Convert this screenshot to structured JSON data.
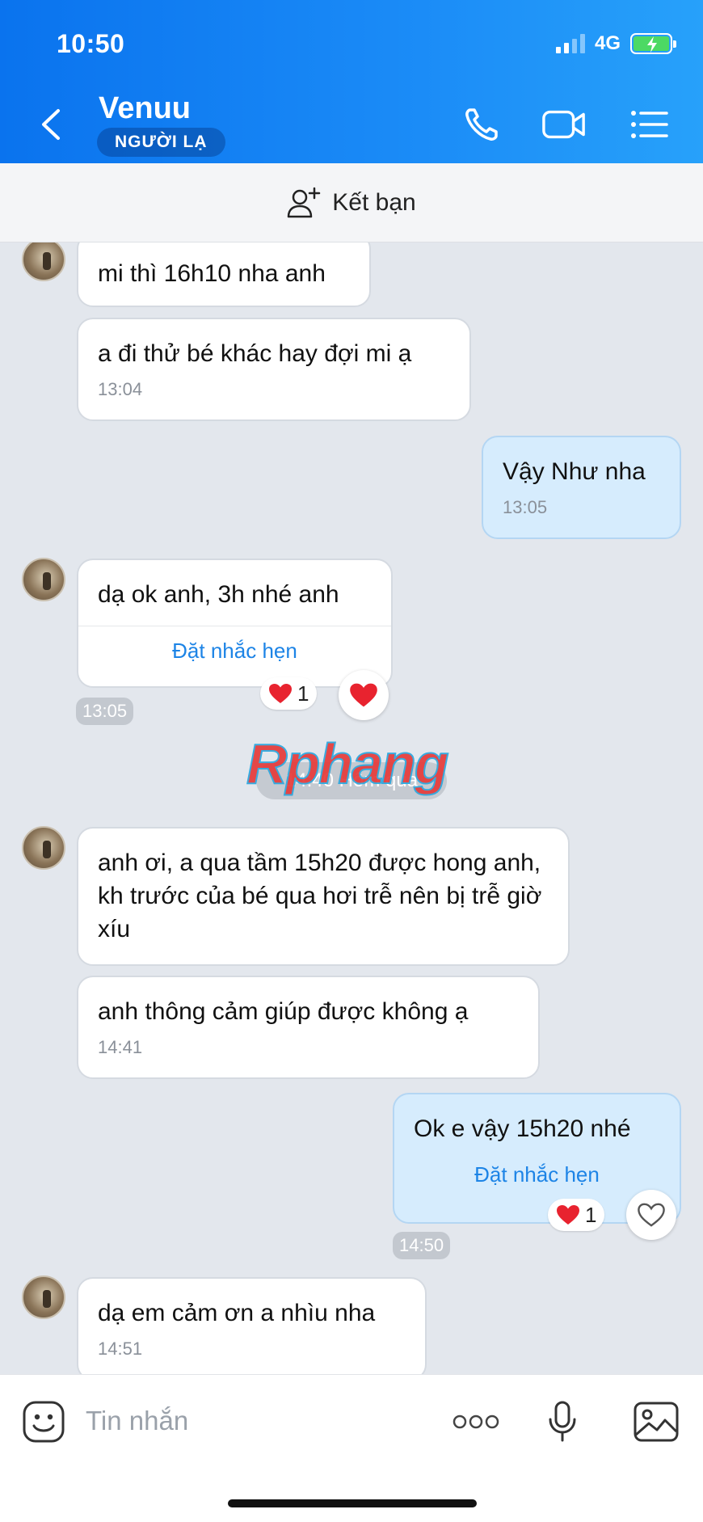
{
  "status_bar": {
    "time": "10:50",
    "network": "4G"
  },
  "header": {
    "contact_name": "Venuu",
    "badge": "NGƯỜI LẠ",
    "icons": [
      "back-icon",
      "phone-icon",
      "video-call-icon",
      "menu-list-icon"
    ]
  },
  "add_friend": {
    "label": "Kết bạn",
    "icon": "add-friend-icon"
  },
  "messages": [
    {
      "from": "them",
      "text": "mi thì 16h10 nha anh"
    },
    {
      "from": "them",
      "text": "a đi thử bé khác hay đợi mi ạ",
      "time": "13:04"
    },
    {
      "from": "me",
      "text": "Vậy Như nha",
      "time": "13:05"
    },
    {
      "from": "them",
      "text": "dạ ok anh, 3h nhé anh",
      "action": "Đặt nhắc hẹn",
      "time": "13:05",
      "reaction_count": "1"
    },
    {
      "from": "them",
      "text": "anh ơi, a qua tầm 15h20 được hong anh, kh trước của bé qua hơi trễ nên bị trễ giờ xíu"
    },
    {
      "from": "them",
      "text": "anh thông cảm giúp được không ạ",
      "time": "14:41"
    },
    {
      "from": "me",
      "text": "Ok e vậy 15h20 nhé",
      "action": "Đặt nhắc hẹn",
      "time": "14:50",
      "reaction_count": "1"
    },
    {
      "from": "them",
      "text": "dạ em cảm ơn a nhìu nha",
      "time": "14:51"
    }
  ],
  "day_separator": "14:40 Hôm qua",
  "watermark": "Rphang",
  "composer": {
    "placeholder": "Tin nhắn",
    "more_label": "ooo"
  },
  "colors": {
    "header": "#0a73ee",
    "my_bubble": "#d6ecfd",
    "link": "#1d84e6",
    "heart": "#e8232f"
  }
}
